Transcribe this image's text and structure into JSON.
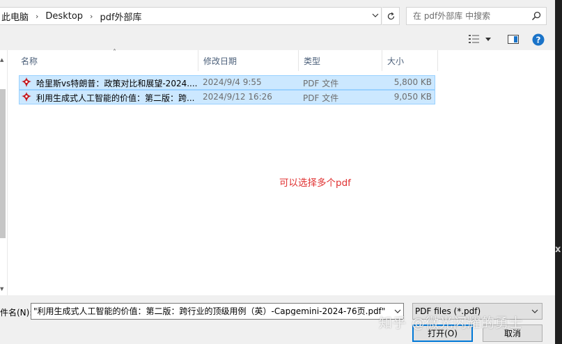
{
  "address_bar": {
    "crumbs": [
      "此电脑",
      "Desktop",
      "pdf外部库"
    ]
  },
  "search": {
    "placeholder": "在 pdf外部库 中搜索"
  },
  "columns": {
    "name": "名称",
    "modified": "修改日期",
    "type": "类型",
    "size": "大小"
  },
  "files": [
    {
      "name": "哈里斯vs特朗普：政策对比和展望-2024....",
      "modified": "2024/9/4 9:55",
      "type": "PDF 文件",
      "size": "5,800 KB"
    },
    {
      "name": "利用生成式人工智能的价值：第二版：跨...",
      "modified": "2024/9/12 16:26",
      "type": "PDF 文件",
      "size": "9,050 KB"
    }
  ],
  "annotation": "可以选择多个pdf",
  "footer": {
    "filename_label": "件名(N):",
    "filename_value": "\"利用生成式人工智能的价值：第二版：跨行业的顶级用例（英）-Capgemini-2024-76页.pdf\" \"I",
    "filter_value": "PDF files (*.pdf)",
    "open_label": "打开(O)",
    "cancel_label": "取消"
  },
  "watermark": "知乎 @微光闪耀的勇士",
  "colors": {
    "selection_fill": "#cce8ff",
    "selection_border": "#99d1ff",
    "annotation": "#e03131",
    "header_text": "#4c607a",
    "help_icon": "#1a73c8",
    "pdf_icon": "#c4161c"
  }
}
